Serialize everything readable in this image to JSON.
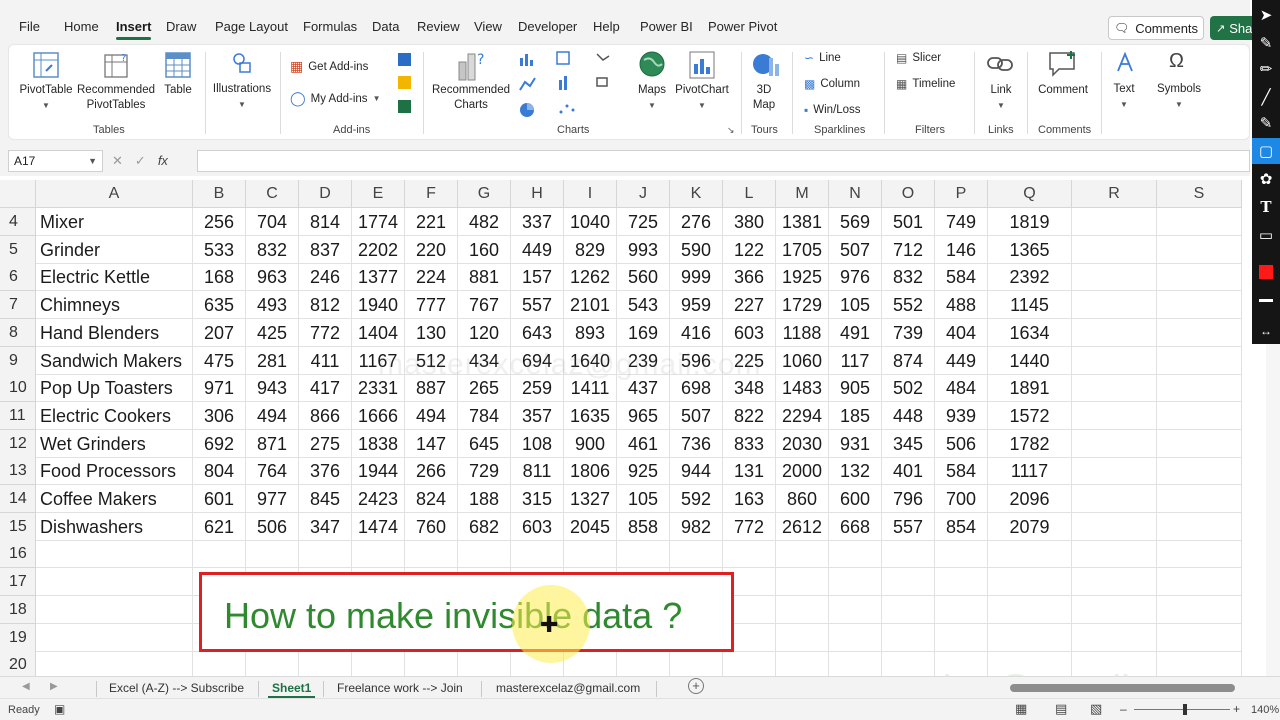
{
  "menu": {
    "items": [
      "File",
      "Home",
      "Insert",
      "Draw",
      "Page Layout",
      "Formulas",
      "Data",
      "Review",
      "View",
      "Developer",
      "Help",
      "Power BI",
      "Power Pivot"
    ],
    "active": "Insert",
    "comments_label": "Comments",
    "share_label": "Share"
  },
  "ribbon": {
    "tables": {
      "pivottable": "PivotTable",
      "recommended": "Recommended PivotTables",
      "table": "Table",
      "group": "Tables"
    },
    "illustrations": {
      "label": "Illustrations"
    },
    "addins": {
      "get": "Get Add-ins",
      "my": "My Add-ins",
      "group": "Add-ins"
    },
    "charts": {
      "recommended": "Recommended Charts",
      "maps": "Maps",
      "pivotchart": "PivotChart",
      "group": "Charts"
    },
    "tours": {
      "map3d": "3D Map",
      "group": "Tours"
    },
    "sparklines": {
      "line": "Line",
      "column": "Column",
      "winloss": "Win/Loss",
      "group": "Sparklines"
    },
    "filters": {
      "slicer": "Slicer",
      "timeline": "Timeline",
      "group": "Filters"
    },
    "links": {
      "link": "Link",
      "group": "Links"
    },
    "comments": {
      "comment": "Comment",
      "group": "Comments"
    },
    "text": {
      "label": "Text"
    },
    "symbols": {
      "label": "Symbols"
    }
  },
  "formula_bar": {
    "namebox": "A17",
    "fx": "fx",
    "value": ""
  },
  "columns": [
    "A",
    "B",
    "C",
    "D",
    "E",
    "F",
    "G",
    "H",
    "I",
    "J",
    "K",
    "L",
    "M",
    "N",
    "O",
    "P",
    "Q",
    "R",
    "S"
  ],
  "rows": [
    {
      "num": "4",
      "name": "Mixer",
      "values": [
        "256",
        "704",
        "814",
        "1774",
        "221",
        "482",
        "337",
        "1040",
        "725",
        "276",
        "380",
        "1381",
        "569",
        "501",
        "749",
        "1819"
      ]
    },
    {
      "num": "5",
      "name": "Grinder",
      "values": [
        "533",
        "832",
        "837",
        "2202",
        "220",
        "160",
        "449",
        "829",
        "993",
        "590",
        "122",
        "1705",
        "507",
        "712",
        "146",
        "1365"
      ]
    },
    {
      "num": "6",
      "name": "Electric Kettle",
      "values": [
        "168",
        "963",
        "246",
        "1377",
        "224",
        "881",
        "157",
        "1262",
        "560",
        "999",
        "366",
        "1925",
        "976",
        "832",
        "584",
        "2392"
      ]
    },
    {
      "num": "7",
      "name": "Chimneys",
      "values": [
        "635",
        "493",
        "812",
        "1940",
        "777",
        "767",
        "557",
        "2101",
        "543",
        "959",
        "227",
        "1729",
        "105",
        "552",
        "488",
        "1145"
      ]
    },
    {
      "num": "8",
      "name": "Hand Blenders",
      "values": [
        "207",
        "425",
        "772",
        "1404",
        "130",
        "120",
        "643",
        "893",
        "169",
        "416",
        "603",
        "1188",
        "491",
        "739",
        "404",
        "1634"
      ]
    },
    {
      "num": "9",
      "name": "Sandwich Makers",
      "values": [
        "475",
        "281",
        "411",
        "1167",
        "512",
        "434",
        "694",
        "1640",
        "239",
        "596",
        "225",
        "1060",
        "117",
        "874",
        "449",
        "1440"
      ]
    },
    {
      "num": "10",
      "name": "Pop Up Toasters",
      "values": [
        "971",
        "943",
        "417",
        "2331",
        "887",
        "265",
        "259",
        "1411",
        "437",
        "698",
        "348",
        "1483",
        "905",
        "502",
        "484",
        "1891"
      ]
    },
    {
      "num": "11",
      "name": "Electric Cookers",
      "values": [
        "306",
        "494",
        "866",
        "1666",
        "494",
        "784",
        "357",
        "1635",
        "965",
        "507",
        "822",
        "2294",
        "185",
        "448",
        "939",
        "1572"
      ]
    },
    {
      "num": "12",
      "name": "Wet Grinders",
      "values": [
        "692",
        "871",
        "275",
        "1838",
        "147",
        "645",
        "108",
        "900",
        "461",
        "736",
        "833",
        "2030",
        "931",
        "345",
        "506",
        "1782"
      ]
    },
    {
      "num": "13",
      "name": "Food Processors",
      "values": [
        "804",
        "764",
        "376",
        "1944",
        "266",
        "729",
        "811",
        "1806",
        "925",
        "944",
        "131",
        "2000",
        "132",
        "401",
        "584",
        "1117"
      ]
    },
    {
      "num": "14",
      "name": "Coffee Makers",
      "values": [
        "601",
        "977",
        "845",
        "2423",
        "824",
        "188",
        "315",
        "1327",
        "105",
        "592",
        "163",
        "860",
        "600",
        "796",
        "700",
        "2096"
      ]
    },
    {
      "num": "15",
      "name": "Dishwashers",
      "values": [
        "621",
        "506",
        "347",
        "1474",
        "760",
        "682",
        "603",
        "2045",
        "858",
        "982",
        "772",
        "2612",
        "668",
        "557",
        "854",
        "2079"
      ]
    },
    {
      "num": "16",
      "name": "",
      "values": []
    },
    {
      "num": "17",
      "name": "",
      "values": []
    },
    {
      "num": "18",
      "name": "",
      "values": []
    },
    {
      "num": "19",
      "name": "",
      "values": []
    },
    {
      "num": "20",
      "name": "",
      "values": []
    }
  ],
  "callout": {
    "text": "How to make invisible data ?"
  },
  "watermark": "masterexcelaz@gmail.com",
  "sheet_tabs": [
    "Excel (A-Z) --> Subscribe",
    "Sheet1",
    "Freelance work --> Join",
    "masterexcelaz@gmail.com"
  ],
  "active_sheet": "Sheet1",
  "status": {
    "ready": "Ready",
    "zoom": "140%"
  },
  "colors": {
    "accent": "#1e7145",
    "callout_border": "#e02020",
    "callout_text": "#2f8a2f"
  },
  "draw_tools": [
    "select-icon",
    "pen-icon",
    "highlighter-icon",
    "pencil-icon",
    "marker-icon",
    "rectangle-icon",
    "palette-icon",
    "text-icon",
    "eraser-icon",
    "red-color-icon",
    "line-weight-icon",
    "swap-icon"
  ]
}
